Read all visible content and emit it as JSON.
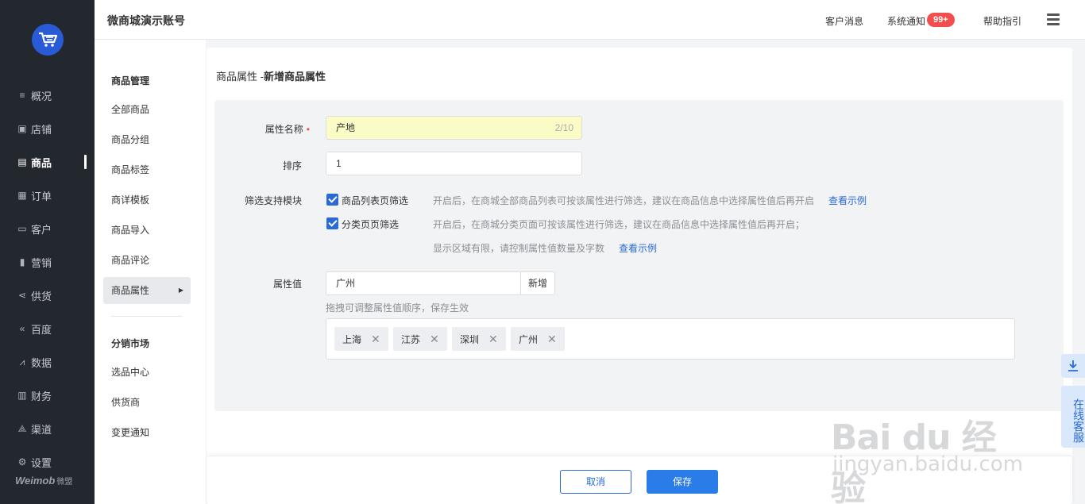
{
  "sidebar": {
    "items": [
      {
        "label": "概况",
        "icon": "list-icon"
      },
      {
        "label": "店铺",
        "icon": "shop-icon"
      },
      {
        "label": "商品",
        "icon": "goods-icon",
        "active": true
      },
      {
        "label": "订单",
        "icon": "order-icon"
      },
      {
        "label": "客户",
        "icon": "customer-icon"
      },
      {
        "label": "营销",
        "icon": "marketing-icon"
      },
      {
        "label": "供货",
        "icon": "share-icon"
      },
      {
        "label": "百度",
        "icon": "baidu-icon"
      },
      {
        "label": "数据",
        "icon": "chart-icon"
      },
      {
        "label": "财务",
        "icon": "finance-icon"
      },
      {
        "label": "渠道",
        "icon": "channel-icon"
      },
      {
        "label": "设置",
        "icon": "gear-icon"
      }
    ],
    "brand": "Weimob",
    "brand_sub": "微盟"
  },
  "header": {
    "account_name": "微商城演示账号",
    "customer_msg": "客户消息",
    "system_notice": "系统通知",
    "notice_badge": "99+",
    "help": "帮助指引"
  },
  "subnav": {
    "group1_title": "商品管理",
    "group1_items": [
      "全部商品",
      "商品分组",
      "商品标签",
      "商详模板",
      "商品导入",
      "商品评论",
      "商品属性"
    ],
    "group2_title": "分销市场",
    "group2_items": [
      "选品中心",
      "供货商",
      "变更通知"
    ]
  },
  "page": {
    "title_prefix": "商品属性 -",
    "title_bold": "新增商品属性"
  },
  "form": {
    "name_label": "属性名称",
    "name_value": "产地",
    "name_count": "2/10",
    "sort_label": "排序",
    "sort_value": "1",
    "filter_label": "筛选支持模块",
    "filter_opt1": "商品列表页筛选",
    "filter_opt1_hint": "开启后，在商城全部商品列表可按该属性进行筛选，建议在商品信息中选择属性值后再开启",
    "filter_opt1_link": "查看示例",
    "filter_opt2": "分类页页筛选",
    "filter_opt2_hint": "开启后，在商城分类页面可按该属性进行筛选，建议在商品信息中选择属性值后再开启；",
    "filter_opt2_hint2": "显示区域有限，请控制属性值数量及字数",
    "filter_opt2_link": "查看示例",
    "value_label": "属性值",
    "value_input": "广州",
    "add_button": "新增",
    "drag_hint": "拖拽可调整属性值顺序，保存生效",
    "tags": [
      "上海",
      "江苏",
      "深圳",
      "广州"
    ]
  },
  "footer": {
    "cancel": "取消",
    "save": "保存"
  },
  "floating": {
    "service": "在线客服"
  },
  "watermark": {
    "main": "Bai du 经验",
    "sub": "jingyan.baidu.com"
  },
  "colors": {
    "sidebar_bg": "#23272e",
    "primary": "#2a6ad6",
    "badge": "#f44d4d",
    "highlight_input": "#fbfbc6"
  }
}
